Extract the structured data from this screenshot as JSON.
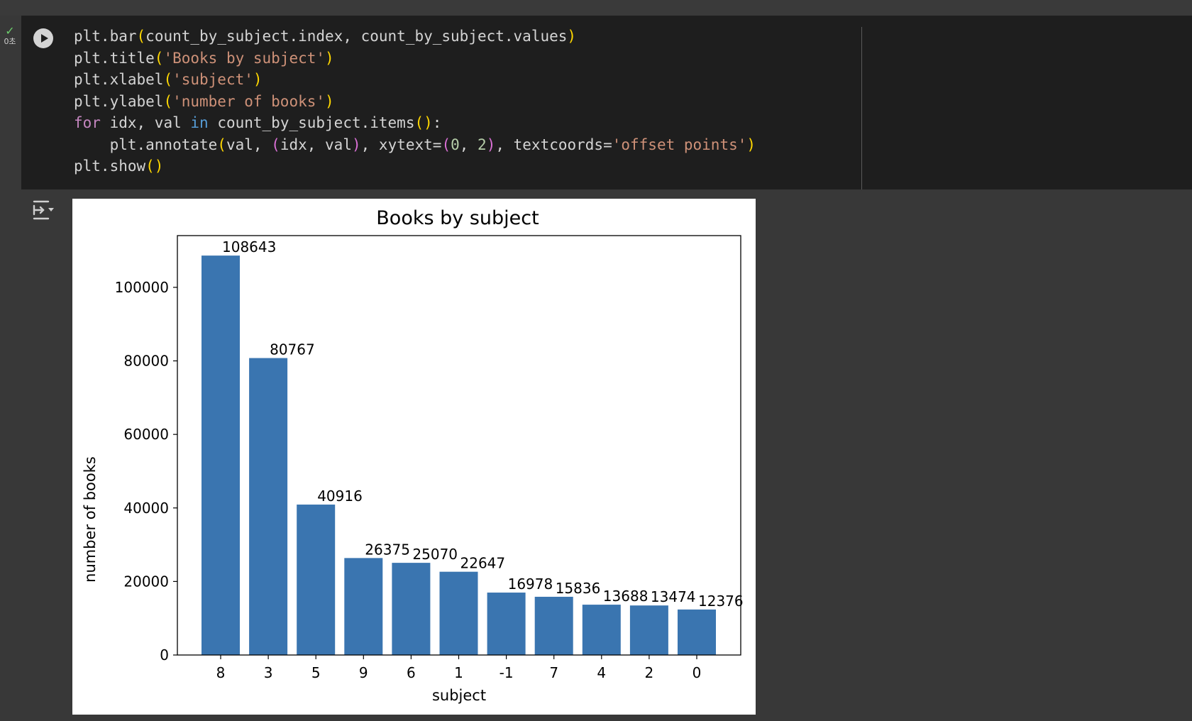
{
  "cell": {
    "status_icon": "check-icon",
    "exec_time": "0초",
    "run_icon": "play-icon",
    "output_icon": "output-options-icon"
  },
  "code_lines": [
    "plt.bar(count_by_subject.index, count_by_subject.values)",
    "plt.title('Books by subject')",
    "plt.xlabel('subject')",
    "plt.ylabel('number of books')",
    "for idx, val in count_by_subject.items():",
    "    plt.annotate(val, (idx, val), xytext=(0, 2), textcoords='offset points')",
    "plt.show()"
  ],
  "colors": {
    "bar": "#3a75b0",
    "cell_bg": "#1e1e1e",
    "page_bg": "#383838"
  },
  "chart_data": {
    "type": "bar",
    "title": "Books by subject",
    "xlabel": "subject",
    "ylabel": "number of books",
    "categories": [
      "8",
      "3",
      "5",
      "9",
      "6",
      "1",
      "-1",
      "7",
      "4",
      "2",
      "0"
    ],
    "values": [
      108643,
      80767,
      40916,
      26375,
      25070,
      22647,
      16978,
      15836,
      13688,
      13474,
      12376
    ],
    "data_labels": [
      "108643",
      "80767",
      "40916",
      "26375",
      "25070",
      "22647",
      "16978",
      "15836",
      "13688",
      "13474",
      "12376"
    ],
    "yticks": [
      0,
      20000,
      40000,
      60000,
      80000,
      100000
    ],
    "ytick_labels": [
      "0",
      "20000",
      "40000",
      "60000",
      "80000",
      "100000"
    ],
    "ylim": [
      0,
      114075
    ],
    "grid": false,
    "legend": false
  }
}
